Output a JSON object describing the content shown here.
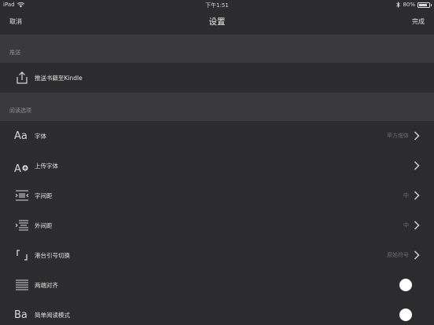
{
  "status": {
    "device": "iPad",
    "time": "下午1:51",
    "battery": "80%",
    "battery_level": 0.8
  },
  "nav": {
    "cancel": "取消",
    "title": "设置",
    "done": "完成"
  },
  "sections": {
    "push_header": "推送",
    "reading_header": "阅读选项"
  },
  "push": {
    "send_label": "推送书籍至Kindle"
  },
  "reading": {
    "font_label": "字体",
    "font_value": "苹方细体",
    "upload_font_label": "上传字体",
    "letter_spacing_label": "字间距",
    "letter_spacing_value": "中",
    "margin_label": "外间距",
    "margin_value": "中",
    "quote_label": "港台引号切换",
    "quote_value": "原始符号",
    "justify_label": "两端对齐",
    "simple_mode_label": "简单阅读模式"
  },
  "icons": {
    "font": "Aa",
    "upload_font": "A",
    "simple_mode": "Ba"
  },
  "colors": {
    "background": "#3a3a3c",
    "row": "#2c2c2e",
    "text": "#e4e4e4",
    "muted": "#8e8e93",
    "toggle_knob": "#ffffff"
  }
}
